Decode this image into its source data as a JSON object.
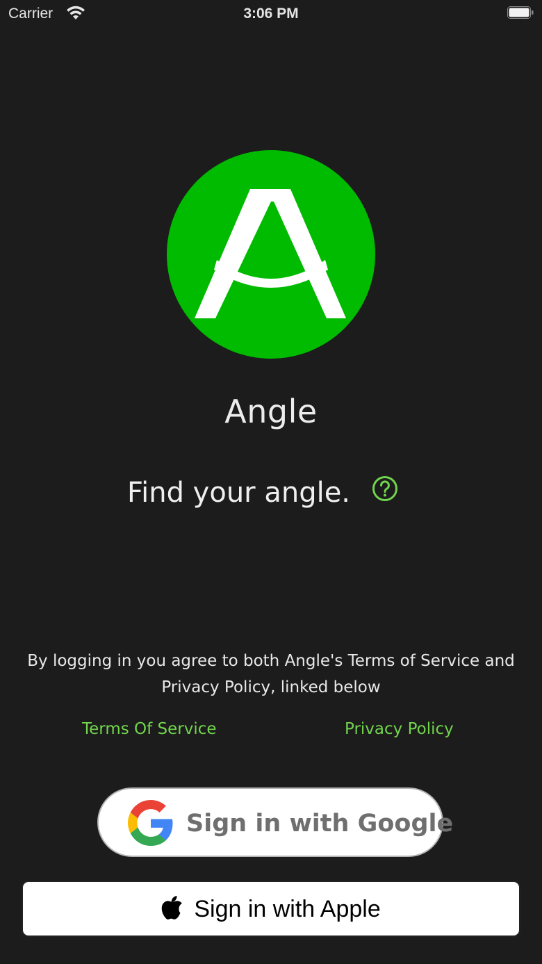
{
  "status_bar": {
    "carrier": "Carrier",
    "time": "3:06 PM",
    "wifi_icon": "wifi-icon",
    "battery_icon": "battery-icon"
  },
  "app": {
    "name": "Angle",
    "tagline": "Find your angle.",
    "logo_icon": "angle-logo-icon",
    "help_icon": "question-circle-icon"
  },
  "legal": {
    "notice": "By logging in you agree to both Angle's Terms of Service and Privacy Policy, linked below",
    "terms_label": "Terms Of Service",
    "privacy_label": "Privacy Policy"
  },
  "auth": {
    "google_label": "Sign in with Google",
    "apple_label": "Sign in with Apple",
    "google_icon": "google-icon",
    "apple_icon": "apple-icon"
  },
  "colors": {
    "background": "#1b1c1b",
    "accent_green": "#00bb00",
    "link_green": "#72d44e"
  }
}
